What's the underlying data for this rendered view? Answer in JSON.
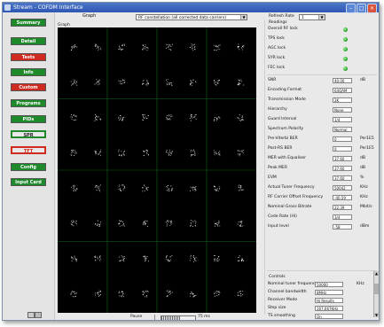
{
  "window": {
    "title": "Stream - COFDM Interface"
  },
  "sidebar": {
    "buttons": [
      {
        "label": "Summary",
        "style": "green"
      },
      {
        "label": "Detail",
        "style": "green"
      },
      {
        "label": "Tests",
        "style": "red"
      },
      {
        "label": "Info",
        "style": "green"
      },
      {
        "label": "Custom",
        "style": "red"
      },
      {
        "label": "Programs",
        "style": "green"
      },
      {
        "label": "PIDs",
        "style": "green"
      },
      {
        "label": "SPR",
        "style": "outline"
      },
      {
        "label": "TFT",
        "style": "outline-red"
      },
      {
        "label": "Config",
        "style": "green"
      },
      {
        "label": "Input Card",
        "style": "green"
      }
    ]
  },
  "toolbar": {
    "graph_label": "Graph",
    "graph_select": "RF constellation (all corrected data carriers)",
    "refresh_label": "Refresh Rate",
    "refresh_value": "1"
  },
  "graph": {
    "label": "Graph"
  },
  "readings": {
    "title": "Readings",
    "locks": [
      {
        "label": "Overall RF lock"
      },
      {
        "label": "TPS lock"
      },
      {
        "label": "AGC lock"
      },
      {
        "label": "SYR lock"
      },
      {
        "label": "FEC lock"
      }
    ],
    "rows": [
      {
        "label": "SNR",
        "value": "40.00",
        "unit": "dB"
      },
      {
        "label": "Encoding Format",
        "value": "64QAM",
        "unit": ""
      },
      {
        "label": "Transmission Mode",
        "value": "2K",
        "unit": ""
      },
      {
        "label": "Hierarchy",
        "value": "None",
        "unit": ""
      },
      {
        "label": "Guard Interval",
        "value": "1/4",
        "unit": ""
      },
      {
        "label": "Spectrum Polarity",
        "value": "Normal",
        "unit": ""
      },
      {
        "label": "Pre-Viterbi BER",
        "value": "0",
        "unit": "Per1E5"
      },
      {
        "label": "Post-RS BER",
        "value": "0",
        "unit": "Per1E5"
      },
      {
        "label": "MER with Equaliser",
        "value": "37.60",
        "unit": "dB"
      },
      {
        "label": "Peak MER",
        "value": "37.60",
        "unit": "dB"
      },
      {
        "label": "EVM",
        "value": "37.60",
        "unit": "%"
      },
      {
        "label": "Actual Tuner Frequency",
        "value": "50042",
        "unit": "KHz"
      },
      {
        "label": "RF Carrier Offset Frequency",
        "value": "-40.59",
        "unit": "KHz"
      },
      {
        "label": "Nominal Gross Bitrate",
        "value": "22.39",
        "unit": "Mbit/s"
      },
      {
        "label": "Code Rate (Hi)",
        "value": "3/4",
        "unit": ""
      },
      {
        "label": "Input level",
        "value": "-58",
        "unit": "dBm"
      }
    ]
  },
  "controls": {
    "title": "Controls",
    "rows": [
      {
        "label": "Nominal tuner frequency",
        "value": "50000",
        "unit": "KHz"
      },
      {
        "label": "Channel bandwidth",
        "value": "8MHz",
        "unit": ""
      },
      {
        "label": "Receiver Mode",
        "value": "Hi Results",
        "unit": ""
      },
      {
        "label": "Step size",
        "value": "167.667KHz",
        "unit": ""
      },
      {
        "label": "TS smoothing",
        "value": "On",
        "unit": ""
      }
    ]
  },
  "status": {
    "pause_label": "Pause",
    "ms_label": "75 ms",
    "progress": 0.55
  }
}
